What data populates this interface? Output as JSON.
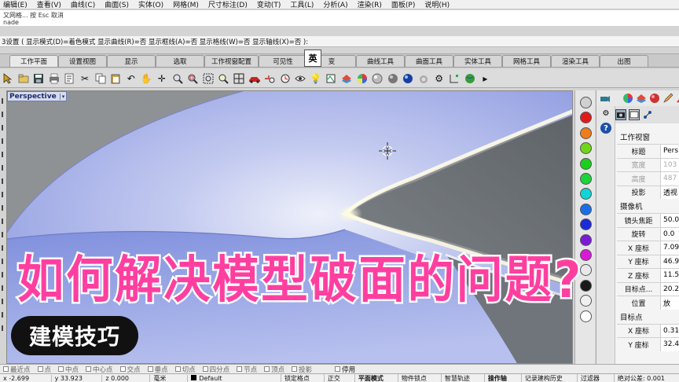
{
  "menu": [
    "编辑(E)",
    "查看(V)",
    "曲线(C)",
    "曲面(S)",
    "实体(O)",
    "网格(M)",
    "尺寸标注(D)",
    "变动(T)",
    "工具(L)",
    "分析(A)",
    "渲染(R)",
    "面板(P)",
    "说明(H)"
  ],
  "command_history": [
    "又网格... 按 Esc 取消",
    "nade"
  ],
  "command_line": "3设置 ( 显示模式(D)=着色模式  显示曲线(R)=否  显示框线(A)=否  显示格线(W)=否  显示轴线(X)=否 ):",
  "tabs": [
    "工作平面",
    "设置视图",
    "显示",
    "选取",
    "工作视窗配置",
    "可见性",
    "变",
    "曲线工具",
    "曲面工具",
    "实体工具",
    "网格工具",
    "渲染工具",
    "出图"
  ],
  "active_tab_index": 0,
  "ime_indicator": "英",
  "viewport": {
    "label": "Perspective",
    "dropdown": "▾"
  },
  "color_swatches": [
    "#d0d0d0",
    "#e11a1a",
    "#ee7d1c",
    "#6fd61a",
    "#1ccf1c",
    "#1ad43c",
    "#10d5d5",
    "#1a6fe6",
    "#1c2ad8",
    "#7a1ad8",
    "#d81ad8",
    "#e8e8e8",
    "#1a1a1a",
    "#f0f0f0",
    "#ffffff"
  ],
  "props": {
    "viewport_section": "工作视窗",
    "viewport_rows": [
      {
        "k": "标题",
        "v": "Pers",
        "disabled": false
      },
      {
        "k": "宽度",
        "v": "103",
        "disabled": true
      },
      {
        "k": "高度",
        "v": "487",
        "disabled": true
      },
      {
        "k": "投影",
        "v": "透视",
        "disabled": false
      }
    ],
    "camera_section": "摄像机",
    "camera_rows": [
      {
        "k": "镜头焦距",
        "v": "50.0"
      },
      {
        "k": "旋转",
        "v": "0.0"
      },
      {
        "k": "X 座标",
        "v": "7.09"
      },
      {
        "k": "Y 座标",
        "v": "46.9"
      },
      {
        "k": "Z 座标",
        "v": "11.5"
      },
      {
        "k": "目标点...",
        "v": "20.2"
      },
      {
        "k": "位置",
        "v": "放"
      }
    ],
    "target_section": "目标点",
    "target_rows": [
      {
        "k": "X 座标",
        "v": "0.31"
      },
      {
        "k": "Y 座标",
        "v": "32.4"
      }
    ]
  },
  "osnap": [
    "最近点",
    "点",
    "中点",
    "中心点",
    "交点",
    "垂点",
    "切点",
    "四分点",
    "节点",
    "顶点",
    "投影",
    "停用"
  ],
  "status": {
    "x": "x -2.699",
    "y": "y 33.923",
    "z": "z 0.000",
    "unit": "毫米",
    "layer": "Default",
    "lock_grid": "锁定格点",
    "ortho": "正交",
    "planar": "平面模式",
    "osnap": "物件锁点",
    "smarttrack": "智慧轨迹",
    "gumball": "操作轴",
    "history": "记录建构历史",
    "filter": "过滤器",
    "tolerance": "绝对公差: 0.001"
  },
  "overlay": {
    "title": "如何解决模型破面的问题?",
    "badge": "建模技巧"
  }
}
